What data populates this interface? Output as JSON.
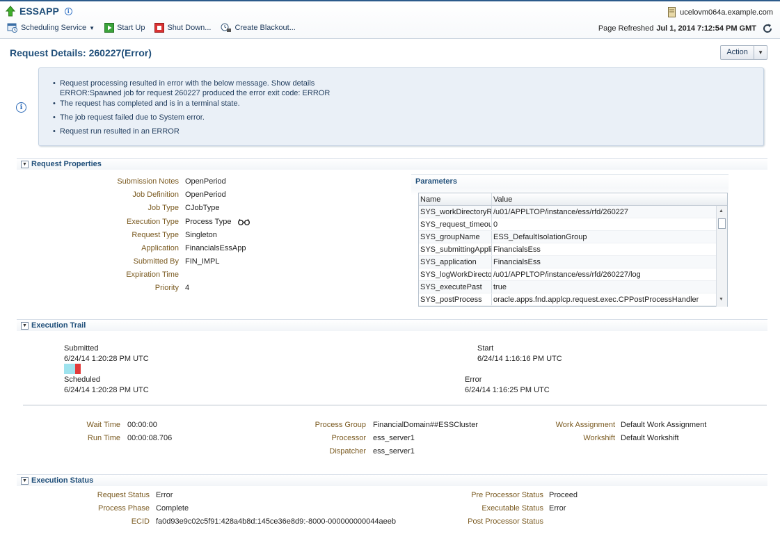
{
  "app": {
    "name": "ESSAPP",
    "host": "ucelovm064a.example.com"
  },
  "toolbar": {
    "scheduling_service": "Scheduling Service",
    "start_up": "Start Up",
    "shut_down": "Shut Down...",
    "create_blackout": "Create Blackout..."
  },
  "refresh": {
    "label": "Page Refreshed",
    "time": "Jul 1, 2014 7:12:54 PM GMT"
  },
  "page": {
    "title": "Request Details: 260227(Error)",
    "action": "Action"
  },
  "messages": {
    "line1": "Request processing resulted in error with the below message.",
    "show_details": "Show details",
    "line1b": "ERROR:Spawned job for request 260227 produced the error exit code: ERROR",
    "line2": "The request has completed and is in a terminal state.",
    "line3": "The job request failed due to System error.",
    "line4": "Request run resulted in an ERROR"
  },
  "request_properties": {
    "title": "Request Properties",
    "fields": [
      {
        "label": "Submission Notes",
        "value": "OpenPeriod"
      },
      {
        "label": "Job Definition",
        "value": "OpenPeriod"
      },
      {
        "label": "Job Type",
        "value": "CJobType"
      },
      {
        "label": "Execution Type",
        "value": "Process Type"
      },
      {
        "label": "Request Type",
        "value": "Singleton"
      },
      {
        "label": "Application",
        "value": "FinancialsEssApp"
      },
      {
        "label": "Submitted By",
        "value": "FIN_IMPL"
      },
      {
        "label": "Expiration Time",
        "value": ""
      },
      {
        "label": "Priority",
        "value": "4"
      }
    ]
  },
  "parameters": {
    "title": "Parameters",
    "columns": [
      "Name",
      "Value"
    ],
    "rows": [
      {
        "name": "SYS_workDirectoryRoot",
        "value": "/u01/APPLTOP/instance/ess/rfd/260227"
      },
      {
        "name": "SYS_request_timeout",
        "value": "0"
      },
      {
        "name": "SYS_groupName",
        "value": "ESS_DefaultIsolationGroup"
      },
      {
        "name": "SYS_submittingApplication",
        "value": "FinancialsEss"
      },
      {
        "name": "SYS_application",
        "value": "FinancialsEss"
      },
      {
        "name": "SYS_logWorkDirectory",
        "value": "/u01/APPLTOP/instance/ess/rfd/260227/log"
      },
      {
        "name": "SYS_executePast",
        "value": "true"
      },
      {
        "name": "SYS_postProcess",
        "value": "oracle.apps.fnd.applcp.request.exec.CPPostProcessHandler"
      }
    ]
  },
  "execution_trail": {
    "title": "Execution Trail",
    "submitted_label": "Submitted",
    "submitted_time": "6/24/14 1:20:28 PM UTC",
    "scheduled_label": "Scheduled",
    "scheduled_time": "6/24/14 1:20:28 PM UTC",
    "start_label": "Start",
    "start_time": "6/24/14 1:16:16 PM UTC",
    "error_label": "Error",
    "error_time": "6/24/14 1:16:25 PM UTC",
    "wait_time_label": "Wait Time",
    "wait_time": "00:00:00",
    "run_time_label": "Run Time",
    "run_time": "00:00:08.706",
    "process_group_label": "Process Group",
    "process_group": "FinancialDomain##ESSCluster",
    "processor_label": "Processor",
    "processor": "ess_server1",
    "dispatcher_label": "Dispatcher",
    "dispatcher": "ess_server1",
    "work_assignment_label": "Work Assignment",
    "work_assignment": "Default Work Assignment",
    "workshift_label": "Workshift",
    "workshift": "Default Workshift"
  },
  "execution_status": {
    "title": "Execution Status",
    "request_status_label": "Request Status",
    "request_status": "Error",
    "process_phase_label": "Process Phase",
    "process_phase": "Complete",
    "ecid_label": "ECID",
    "ecid": "fa0d93e9c02c5f91:428a4b8d:145ce36e8d9:-8000-000000000044aeeb",
    "pre_processor_label": "Pre Processor Status",
    "pre_processor": "Proceed",
    "executable_label": "Executable Status",
    "executable": "Error",
    "post_processor_label": "Post Processor Status",
    "post_processor": ""
  },
  "colors": {
    "accent": "#1f4e79",
    "label": "#7a5a20",
    "error_bar": "#e23b3b",
    "wait_bar": "#9ee3ee"
  }
}
